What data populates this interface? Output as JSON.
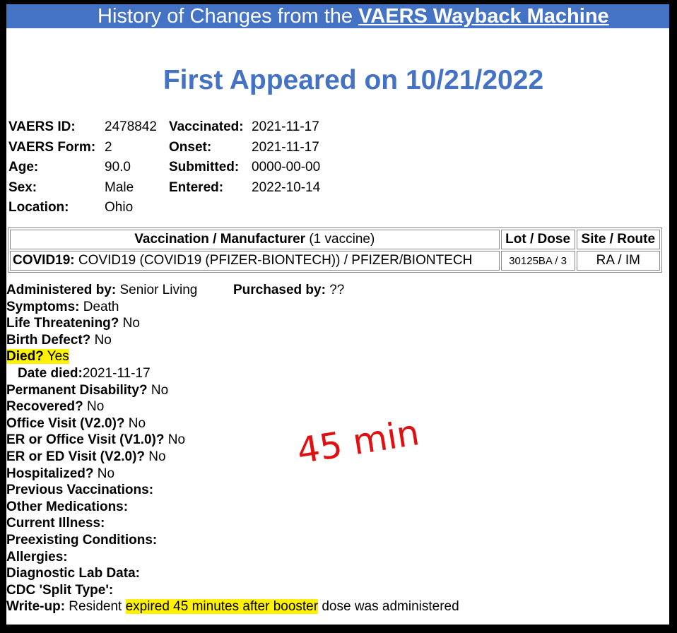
{
  "banner": {
    "prefix": "History of Changes from the ",
    "link": "VAERS Wayback Machine"
  },
  "first_appeared": "First Appeared on 10/21/2022",
  "summary_left": [
    {
      "label": "VAERS ID:",
      "value": "2478842"
    },
    {
      "label": "VAERS Form:",
      "value": "2"
    },
    {
      "label": "Age:",
      "value": "90.0"
    },
    {
      "label": "Sex:",
      "value": "Male"
    },
    {
      "label": "Location:",
      "value": "Ohio"
    }
  ],
  "summary_right": [
    {
      "label": "Vaccinated:",
      "value": "2021-11-17"
    },
    {
      "label": "Onset:",
      "value": "2021-11-17"
    },
    {
      "label": "Submitted:",
      "value": "0000-00-00"
    },
    {
      "label": "Entered:",
      "value": "2022-10-14"
    }
  ],
  "vaccine_table": {
    "headers": {
      "vaccination": "Vaccination / Manufacturer",
      "count": "(1 vaccine)",
      "lot": "Lot / Dose",
      "site": "Site / Route"
    },
    "row": {
      "vaccine_bold": "COVID19:",
      "vaccine_rest": " COVID19 (COVID19 (PFIZER-BIONTECH)) / PFIZER/BIONTECH",
      "lot": "30125BA / 3",
      "site": "RA / IM"
    }
  },
  "details": {
    "administered_label": "Administered by:",
    "administered_value": " Senior Living",
    "purchased_label": "Purchased by:",
    "purchased_value": " ??",
    "symptoms_label": "Symptoms:",
    "symptoms_value": " Death",
    "life_label": "Life Threatening?",
    "life_value": " No",
    "birth_label": "Birth Defect?",
    "birth_value": " No",
    "died_label": "Died?",
    "died_value": " Yes",
    "date_died_label": "Date died:",
    "date_died_value": "2021-11-17",
    "disability_label": "Permanent Disability?",
    "disability_value": " No",
    "recovered_label": "Recovered?",
    "recovered_value": " No",
    "office_label": "Office Visit (V2.0)?",
    "office_value": " No",
    "er_office_label": "ER or Office Visit (V1.0)?",
    "er_office_value": " No",
    "er_ed_label": "ER or ED Visit (V2.0)?",
    "er_ed_value": " No",
    "hosp_label": "Hospitalized?",
    "hosp_value": " No",
    "prev_vacc_label": "Previous Vaccinations:",
    "other_meds_label": "Other Medications:",
    "illness_label": "Current Illness:",
    "preexisting_label": "Preexisting Conditions:",
    "allergies_label": "Allergies:",
    "lab_label": "Diagnostic Lab Data:",
    "split_label": "CDC 'Split Type':",
    "writeup_label": "Write-up:",
    "writeup_pre": " Resident ",
    "writeup_highlight": "expired 45 minutes after booster",
    "writeup_post": " dose was administered"
  },
  "annotation": "45 min",
  "colors": {
    "banner_bg": "#4472c4",
    "heading": "#4472c4",
    "highlight": "#fff200",
    "annotation": "#e01010"
  }
}
